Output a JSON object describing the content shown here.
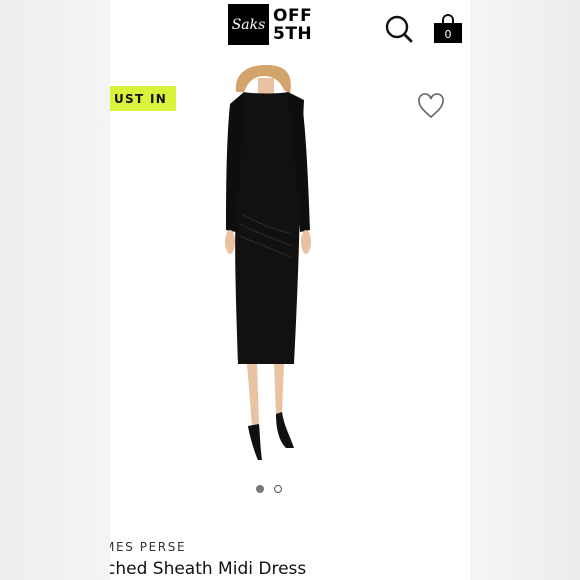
{
  "header": {
    "logo_mark": "Saks",
    "logo_line1": "OFF",
    "logo_line2": "5TH",
    "search_icon": "search-icon",
    "bag_icon": "shopping-bag-icon",
    "bag_count": "0"
  },
  "product": {
    "badge": "UST IN",
    "badge_color": "#d8f33a",
    "favorite_icon": "heart-outline-icon",
    "brand": "MES PERSE",
    "title": "ched Sheath Midi Dress",
    "image_count": 2,
    "active_image": 1,
    "dress_color": "#111111"
  }
}
